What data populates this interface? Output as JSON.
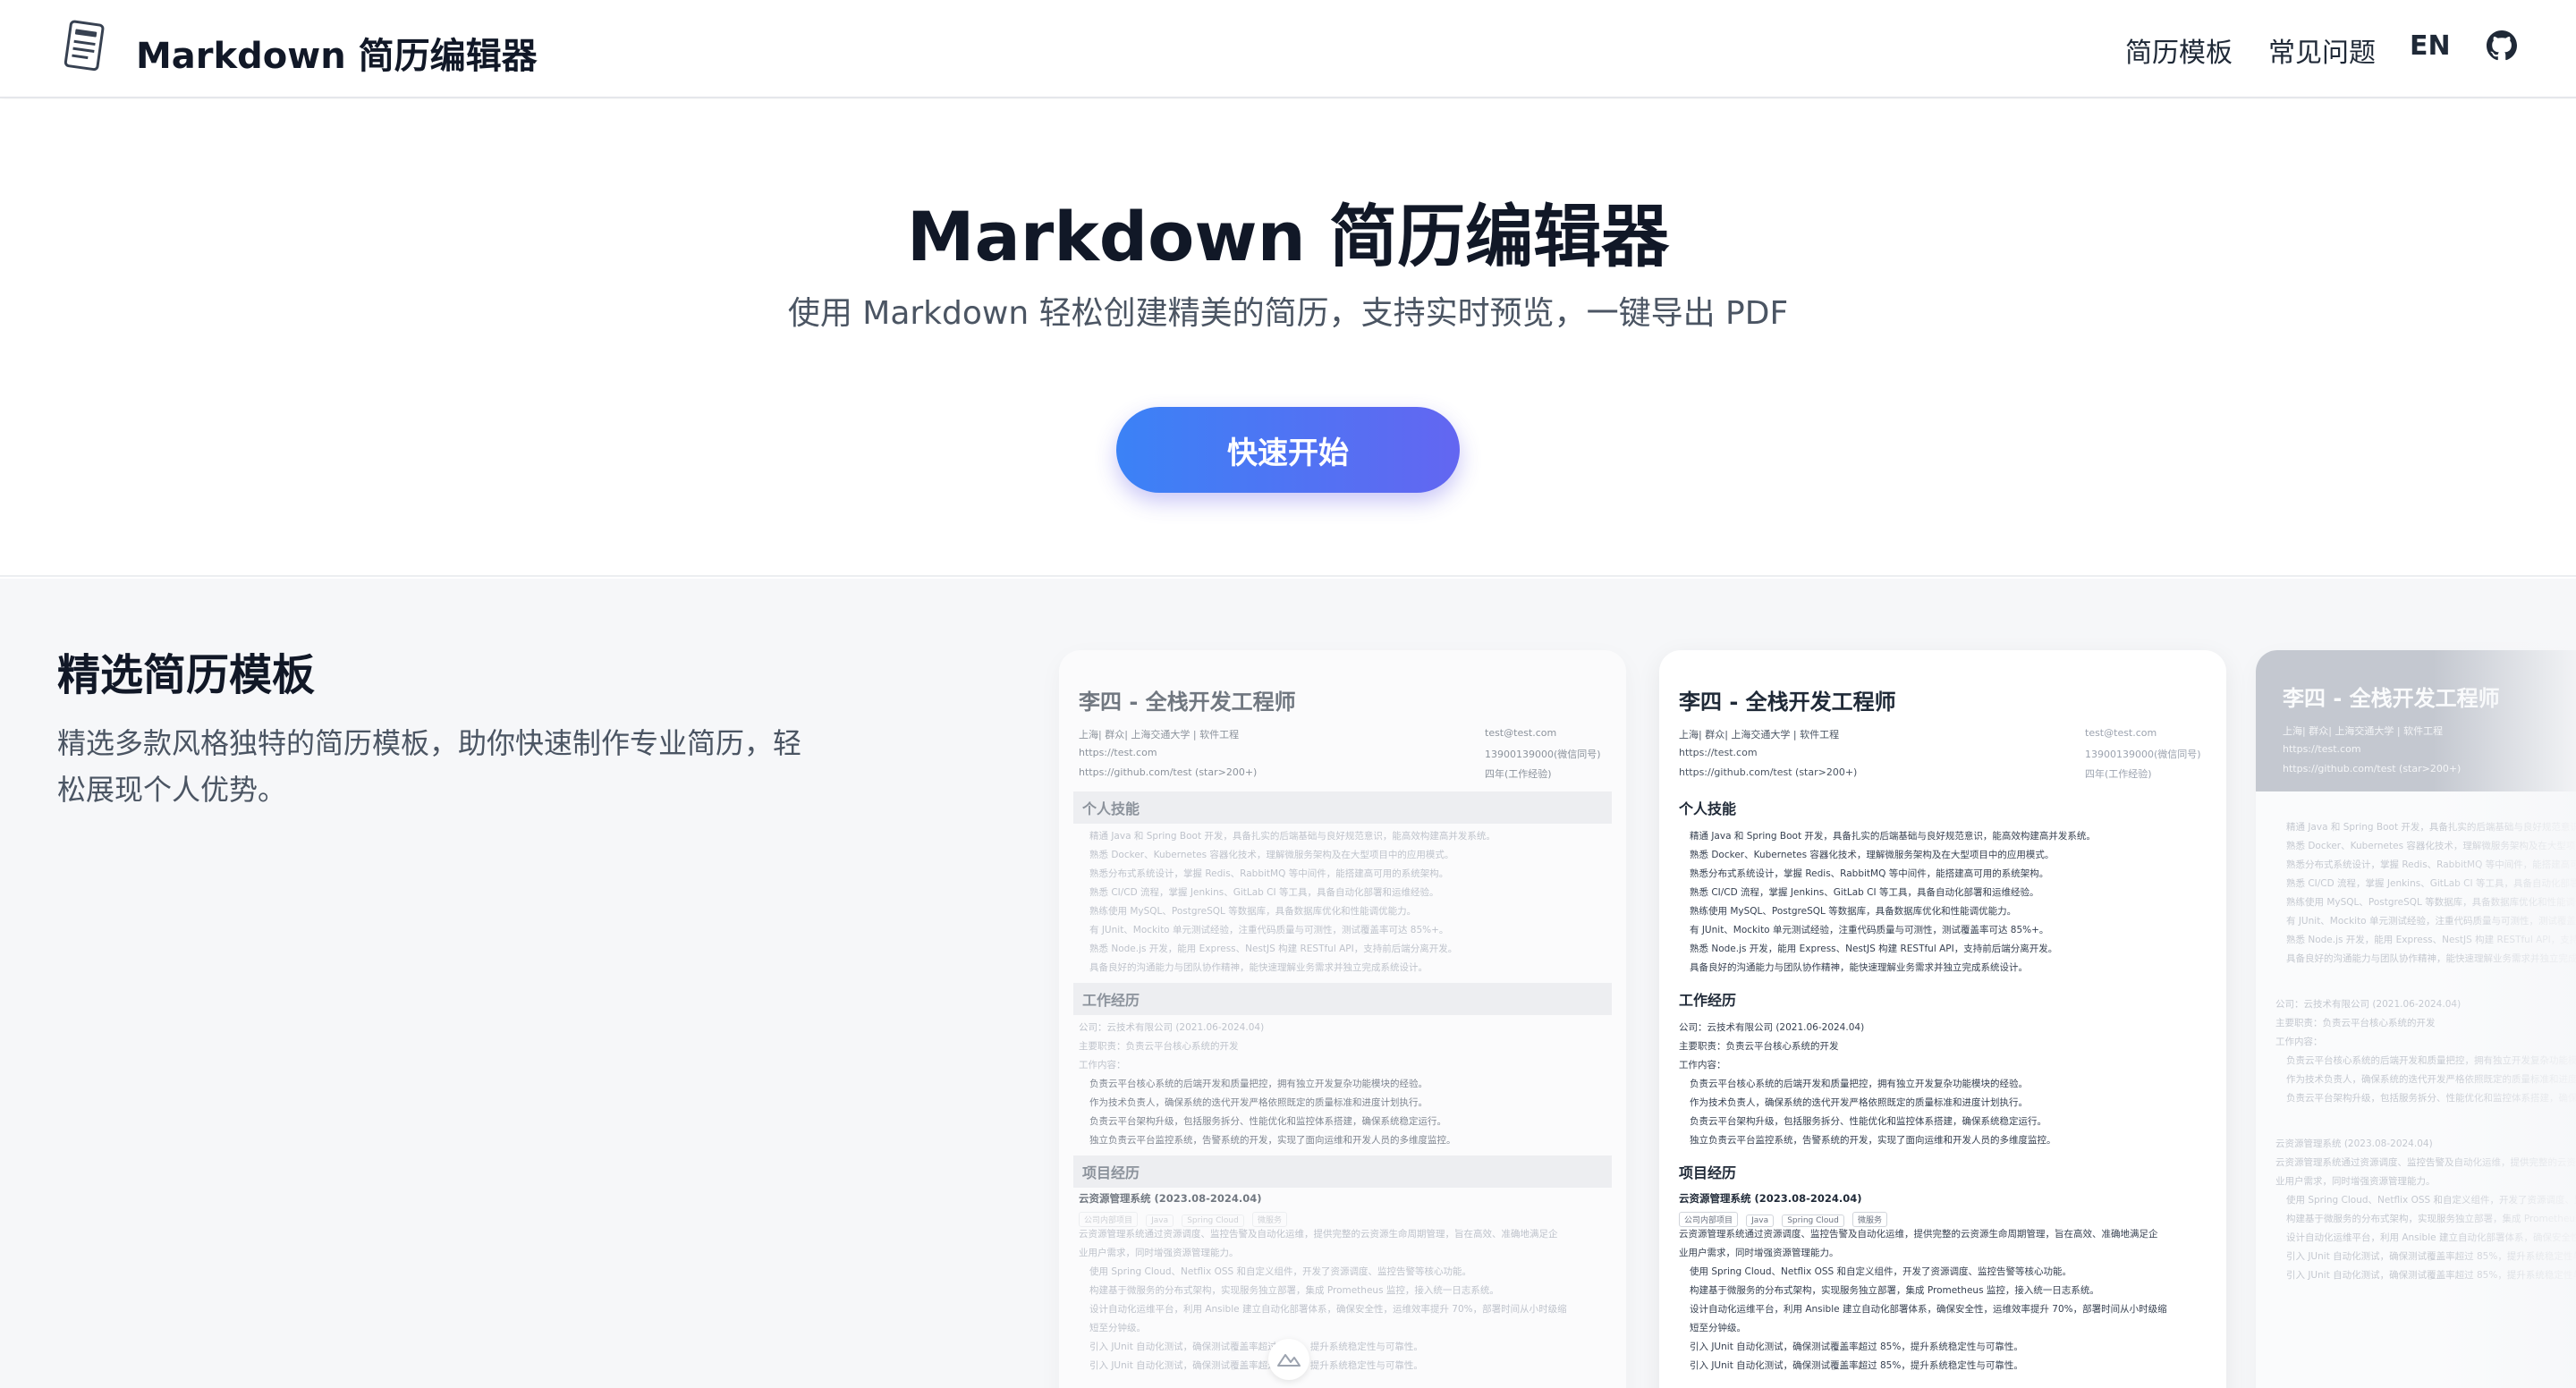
{
  "header": {
    "brand": "Markdown 简历编辑器",
    "nav": {
      "templates": "简历模板",
      "faq": "常见问题",
      "lang": "EN"
    },
    "icons": {
      "logo": "document-notes-icon",
      "github": "github-icon"
    }
  },
  "hero": {
    "title": "Markdown 简历编辑器",
    "subtitle": "使用 Markdown 轻松创建精美的简历，支持实时预览，一键导出 PDF",
    "cta": "快速开始",
    "cta_gradient": [
      "#3b82f6",
      "#6366f1"
    ]
  },
  "templates": {
    "title": "精选简历模板",
    "desc": "精选多款风格独特的简历模板，助你快速制作专业简历，轻松展现个人优势。",
    "scroll_icon": "chevron-mountain-icon"
  },
  "resume": {
    "name": "李四 - 全栈开发工程师",
    "meta_left": [
      "上海| 群众| 上海交通大学 | 软件工程",
      "https://test.com",
      "https://github.com/test (star>200+)"
    ],
    "meta_right": [
      "test@test.com",
      "13900139000(微信同号)",
      "四年(工作经验)"
    ],
    "sections": {
      "skills": "个人技能",
      "work": "工作经历",
      "projects": "项目经历"
    },
    "skills": [
      "精通 Java 和 Spring Boot 开发，具备扎实的后端基础与良好规范意识，能高效构建高并发系统。",
      "熟悉 Docker、Kubernetes 容器化技术，理解微服务架构及在大型项目中的应用模式。",
      "熟悉分布式系统设计，掌握 Redis、RabbitMQ 等中间件，能搭建高可用的系统架构。",
      "熟悉 CI/CD 流程，掌握 Jenkins、GitLab CI 等工具，具备自动化部署和运维经验。",
      "熟练使用 MySQL、PostgreSQL 等数据库，具备数据库优化和性能调优能力。",
      "有 JUnit、Mockito 单元测试经验，注重代码质量与可测性，测试覆盖率可达 85%+。",
      "熟悉 Node.js 开发，能用 Express、NestJS 构建 RESTful API，支持前后端分离开发。",
      "具备良好的沟通能力与团队协作精神，能快速理解业务需求并独立完成系统设计。"
    ],
    "work": {
      "company": "公司：云技术有限公司  (2021.06-2024.04)",
      "role": "主要职责：负责云平台核心系统的开发",
      "content_label": "工作内容：",
      "items": [
        "负责云平台核心系统的后端开发和质量把控，拥有独立开发复杂功能模块的经验。",
        "作为技术负责人，确保系统的迭代开发严格依照既定的质量标准和进度计划执行。",
        "负责云平台架构升级，包括服务拆分、性能优化和监控体系搭建，确保系统稳定运行。",
        "独立负责云平台监控系统，告警系统的开发，实现了面向运维和开发人员的多维度监控。"
      ]
    },
    "project": {
      "title": "云资源管理系统  (2023.08-2024.04)",
      "tags": [
        "公司内部项目",
        "Java",
        "Spring Cloud",
        "微服务"
      ],
      "desc": [
        "云资源管理系统通过资源调度、监控告警及自动化运维，提供完整的云资源生命周期管理，旨在高效、准确地满足企",
        "业用户需求，同时增强资源管理能力。"
      ],
      "items": [
        "使用 Spring Cloud、Netflix OSS 和自定义组件，开发了资源调度、监控告警等核心功能。",
        "构建基于微服务的分布式架构，实现服务独立部署，集成 Prometheus 监控，接入统一日志系统。",
        "设计自动化运维平台，利用 Ansible 建立自动化部署体系，确保安全性，运维效率提升 70%，部署时间从小时级缩",
        "短至分钟级。",
        "引入 JUnit 自动化测试，确保测试覆盖率超过 85%，提升系统稳定性与可靠性。",
        "引入 JUnit 自动化测试，确保测试覆盖率超过 85%，提升系统稳定性与可靠性。"
      ]
    }
  }
}
